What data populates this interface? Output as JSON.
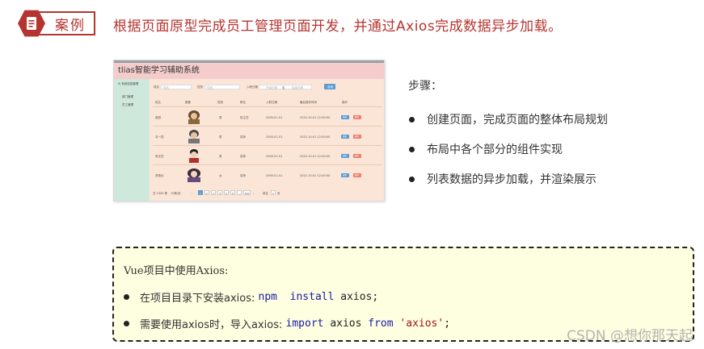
{
  "header": {
    "badge_label": "案例",
    "headline": "根据页面原型完成员工管理页面开发，并通过Axios完成数据异步加载。"
  },
  "mini_screenshot": {
    "title": "tlias智能学习辅助系统",
    "sidebar": {
      "group": "系统信息管理",
      "items": [
        "部门管理",
        "员工管理"
      ]
    },
    "search": {
      "name_label": "姓名",
      "name_placeholder": "姓名",
      "gender_label": "性别",
      "gender_placeholder": "性别",
      "date_label": "入职日期",
      "start_placeholder": "开始日期",
      "to_label": "至",
      "end_placeholder": "结束日期",
      "query_button": "查询"
    },
    "table": {
      "columns": [
        "姓名",
        "图像",
        "性别",
        "职位",
        "入职日期",
        "最后操作时间",
        "操作"
      ],
      "rows": [
        {
          "name": "谢逊",
          "gender": "男",
          "job": "班主任",
          "entry": "2000-01-01",
          "updated": "2022-10-01 12:00:00",
          "edit": "编辑",
          "delete": "删除"
        },
        {
          "name": "韦一笑",
          "gender": "男",
          "job": "讲师",
          "entry": "2000-01-01",
          "updated": "2022-10-01 12:00:00",
          "edit": "编辑",
          "delete": "删除"
        },
        {
          "name": "张无忌",
          "gender": "男",
          "job": "讲师",
          "entry": "2000-01-01",
          "updated": "2022-10-01 12:00:00",
          "edit": "编辑",
          "delete": "删除"
        },
        {
          "name": "黛绮丝",
          "gender": "女",
          "job": "讲师",
          "entry": "2000-01-01",
          "updated": "2022-10-01 12:00:00",
          "edit": "编辑",
          "delete": "删除"
        }
      ]
    },
    "pagination": {
      "total": "共 1000 条",
      "size": "10条/页",
      "pages": [
        "1",
        "2",
        "3",
        "4",
        "5",
        "6",
        "...",
        "100"
      ],
      "goto": "前往",
      "goto_value": "1",
      "page_unit": "页"
    }
  },
  "steps": {
    "title": "步骤：",
    "items": [
      "创建页面，完成页面的整体布局规划",
      "布局中各个部分的组件实现",
      "列表数据的异步加载，并渲染展示"
    ]
  },
  "note": {
    "title": "Vue项目中使用Axios:",
    "line1": {
      "prefix": "在项目目录下安装axios: ",
      "cmd_npm": "npm",
      "cmd_install": "install",
      "cmd_pkg": "axios;"
    },
    "line2": {
      "prefix": "需要使用axios时，导入axios: ",
      "kw_import": "import",
      "ident": "axios",
      "kw_from": "from",
      "str": "'axios'",
      "semi": ";"
    }
  },
  "watermark": "CSDN @想你那天起",
  "colors": {
    "accent_red": "#b5342f",
    "mini_header": "#f4cccc",
    "mini_sidebar": "#cfe8dc",
    "mini_body": "#fbe5d6",
    "note_bg": "#fefee0",
    "primary_blue": "#5b9bd5",
    "danger_red": "#f07c6c"
  }
}
